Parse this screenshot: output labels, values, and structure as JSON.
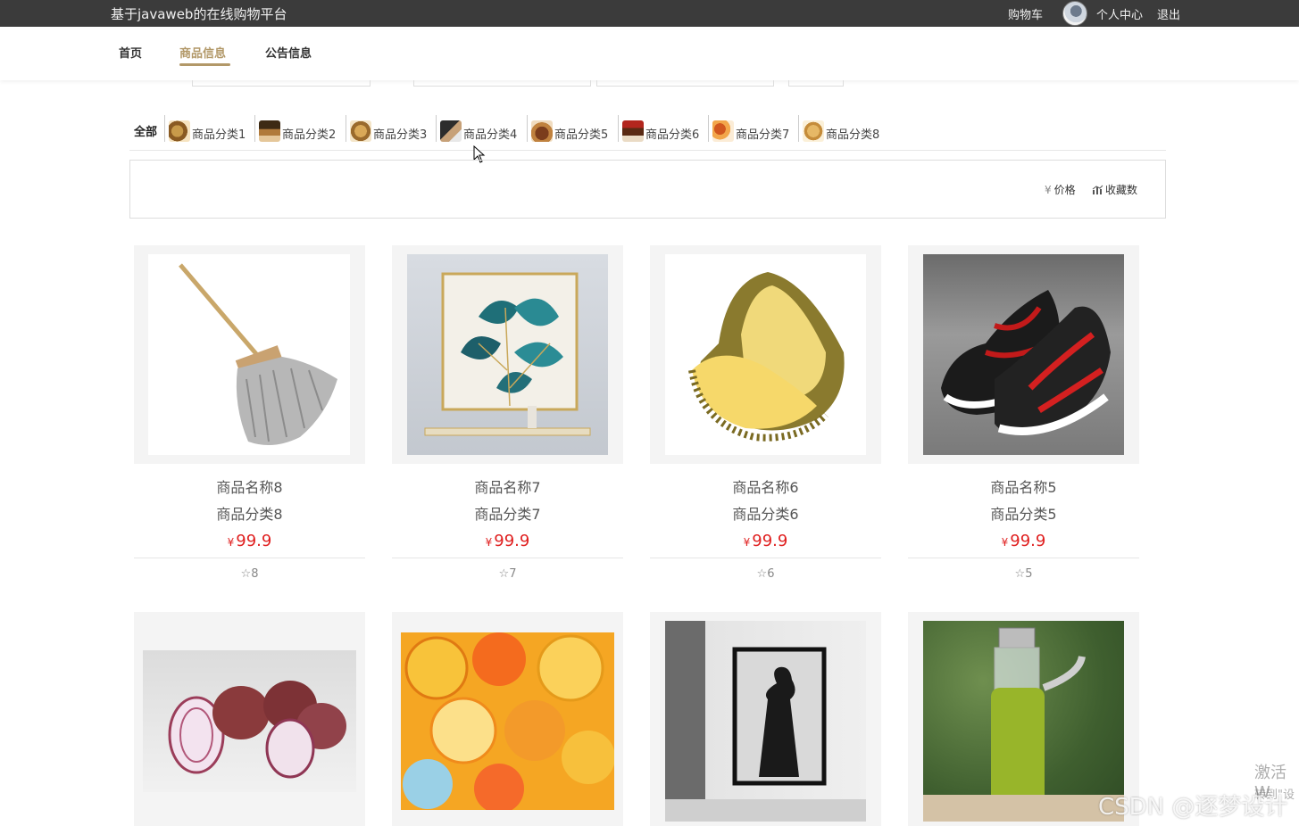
{
  "topbar": {
    "site_title": "基于javaweb的在线购物平台",
    "cart": "购物车",
    "user_center": "个人中心",
    "logout": "退出"
  },
  "nav": {
    "items": [
      "首页",
      "商品信息",
      "公告信息"
    ],
    "active": "商品信息"
  },
  "categories": {
    "all": "全部",
    "items": [
      "商品分类1",
      "商品分类2",
      "商品分类3",
      "商品分类4",
      "商品分类5",
      "商品分类6",
      "商品分类7",
      "商品分类8"
    ]
  },
  "sort": {
    "price_icon": "¥",
    "price": "价格",
    "fav_icon": "chart-icon",
    "fav": "收藏数"
  },
  "products": [
    {
      "name": "商品名称8",
      "category": "商品分类8",
      "price_symbol": "¥",
      "price": "99.9",
      "favs": "8",
      "image": "mop"
    },
    {
      "name": "商品名称7",
      "category": "商品分类7",
      "price_symbol": "¥",
      "price": "99.9",
      "favs": "7",
      "image": "ginkgo-painting"
    },
    {
      "name": "商品名称6",
      "category": "商品分类6",
      "price_symbol": "¥",
      "price": "99.9",
      "favs": "6",
      "image": "durian"
    },
    {
      "name": "商品名称5",
      "category": "商品分类5",
      "price_symbol": "¥",
      "price": "99.9",
      "favs": "5",
      "image": "sneakers"
    },
    {
      "image": "onions"
    },
    {
      "image": "jelly-cups"
    },
    {
      "image": "bw-portrait-painting"
    },
    {
      "image": "green-water-bottle"
    }
  ],
  "watermark": {
    "csdn": "CSDN @逐梦设计",
    "activate": "激活 W",
    "activate_sub": "转到\"设"
  }
}
